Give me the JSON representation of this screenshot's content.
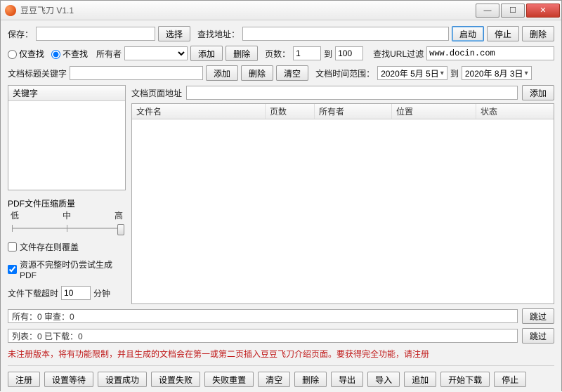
{
  "window": {
    "title": "豆豆飞刀 V1.1"
  },
  "row1": {
    "save_label": "保存：",
    "select_btn": "选择",
    "find_addr_label": "查找地址：",
    "start_btn": "启动",
    "stop_btn": "停止",
    "delete_btn": "删除"
  },
  "row2": {
    "only_search": "仅查找",
    "no_search": "不查找",
    "owner_label": "所有者",
    "add_btn": "添加",
    "del_btn": "删除",
    "pages_label": "页数：",
    "page_from": "1",
    "to_label": "到",
    "page_to": "100",
    "url_filter_label": "查找URL过滤",
    "url_filter_value": "www.docin.com"
  },
  "row3": {
    "title_kw_label": "文档标题关键字",
    "add_btn": "添加",
    "del_btn": "删除",
    "clear_btn": "清空",
    "time_range_label": "文档时间范围：",
    "date_from": "2020年 5月 5日",
    "to_label": "到",
    "date_to": "2020年 8月 3日"
  },
  "left": {
    "kw_header": "关键字",
    "pdf_quality_label": "PDF文件压缩质量",
    "q_low": "低",
    "q_mid": "中",
    "q_high": "高",
    "overwrite": "文件存在则覆盖",
    "try_gen": "资源不完整时仍尝试生成PDF",
    "timeout_label": "文件下载超时",
    "timeout_value": "10",
    "timeout_unit": "分钟"
  },
  "right": {
    "page_addr_label": "文档页面地址",
    "add_btn": "添加",
    "cols": {
      "name": "文件名",
      "pages": "页数",
      "owner": "所有者",
      "location": "位置",
      "status": "状态"
    }
  },
  "status": {
    "line1": "所有：0 审查：0",
    "line2": "列表：0 已下载：0",
    "skip_btn": "跳过"
  },
  "notice": "未注册版本，将有功能限制，并且生成的文档会在第一或第二页插入豆豆飞刀介绍页面。要获得完全功能，请注册",
  "bottom": {
    "b1": "注册",
    "b2": "设置等待",
    "b3": "设置成功",
    "b4": "设置失败",
    "b5": "失败重置",
    "b6": "清空",
    "b7": "删除",
    "b8": "导出",
    "b9": "导入",
    "b10": "追加",
    "b11": "开始下载",
    "b12": "停止"
  }
}
